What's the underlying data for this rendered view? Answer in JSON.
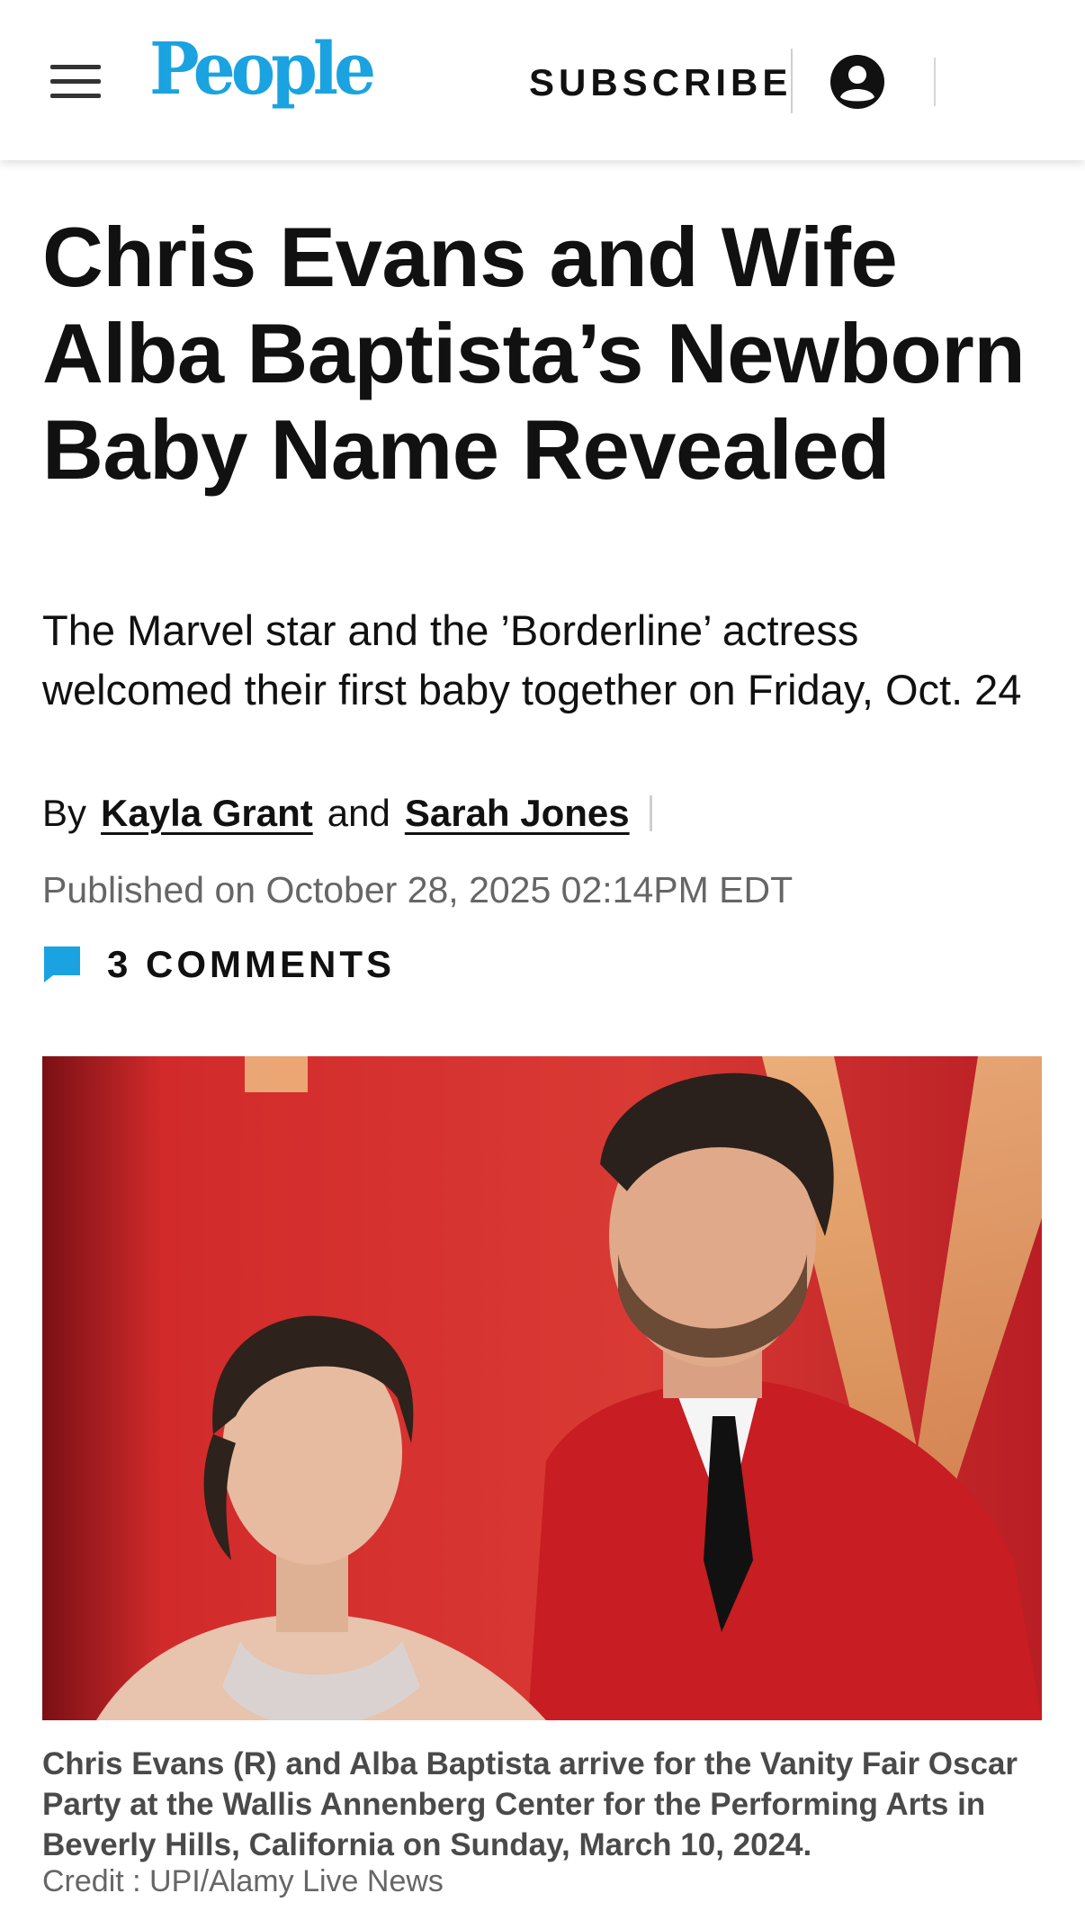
{
  "header": {
    "logo": "People",
    "subscribe_label": "SUBSCRIBE",
    "menu_icon": "hamburger-menu-icon",
    "account_icon": "account-icon",
    "brand_color": "#1aa3e0"
  },
  "article": {
    "headline": "Chris Evans and Wife Alba Baptista’s Newborn Baby Name Revealed",
    "dek": "The Marvel star and the ’Borderline’ actress welcomed their first baby together on Friday, Oct. 24",
    "byline": {
      "prefix": "By",
      "author1": "Kayla Grant",
      "conjunction": "and",
      "author2": "Sarah Jones"
    },
    "published": "Published on October 28, 2025 02:14PM EDT",
    "comments": {
      "label": "3 COMMENTS",
      "icon": "comment-icon",
      "color": "#1aa3e0"
    },
    "image": {
      "caption": "Chris Evans (R) and Alba Baptista arrive for the Vanity Fair Oscar Party at the Wallis Annenberg Center for the Performing Arts in Beverly Hills, California on Sunday, March 10, 2024.",
      "credit": "Credit : UPI/Alamy Live News"
    }
  }
}
